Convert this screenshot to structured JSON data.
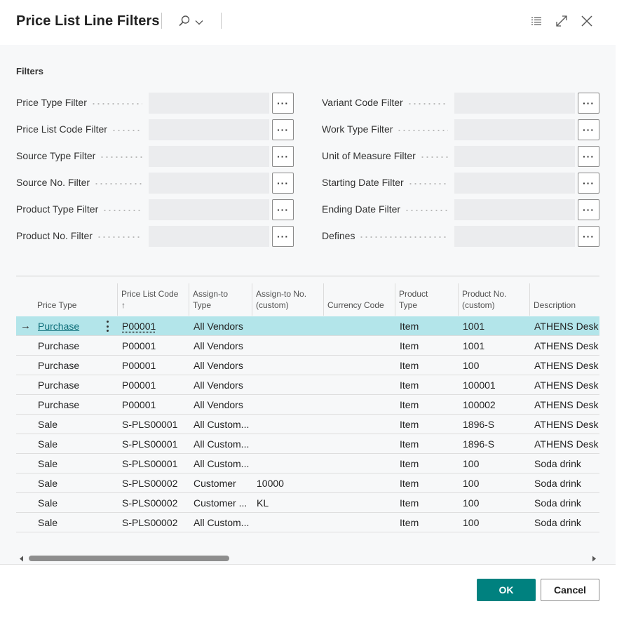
{
  "dialog": {
    "title": "Price List Line Filters",
    "icons": [
      "search-icon",
      "chevron-down-icon",
      "list-icon",
      "expand-icon",
      "close-icon"
    ]
  },
  "filters": {
    "section_title": "Filters",
    "ellipsis": "···",
    "left": [
      {
        "label": "Price Type Filter",
        "value": ""
      },
      {
        "label": "Price List Code Filter",
        "value": ""
      },
      {
        "label": "Source Type Filter",
        "value": ""
      },
      {
        "label": "Source No. Filter",
        "value": ""
      },
      {
        "label": "Product Type Filter",
        "value": ""
      },
      {
        "label": "Product No. Filter",
        "value": ""
      }
    ],
    "right": [
      {
        "label": "Variant Code Filter",
        "value": ""
      },
      {
        "label": "Work Type Filter",
        "value": ""
      },
      {
        "label": "Unit of Measure Filter",
        "value": ""
      },
      {
        "label": "Starting Date Filter",
        "value": ""
      },
      {
        "label": "Ending Date Filter",
        "value": ""
      },
      {
        "label": "Defines",
        "value": ""
      }
    ]
  },
  "table": {
    "columns": [
      {
        "line1": "Price Type",
        "line2": ""
      },
      {
        "line1": "Price List Code",
        "line2": "↑"
      },
      {
        "line1": "Assign-to",
        "line2": "Type"
      },
      {
        "line1": "Assign-to No.",
        "line2": "(custom)"
      },
      {
        "line1": "Currency Code",
        "line2": ""
      },
      {
        "line1": "Product",
        "line2": "Type"
      },
      {
        "line1": "Product No.",
        "line2": "(custom)"
      },
      {
        "line1": "Description",
        "line2": ""
      }
    ],
    "rows": [
      {
        "price_type": "Purchase",
        "price_list_code": "P00001",
        "assign_to_type": "All Vendors",
        "assign_to_no": "",
        "currency_code": "",
        "product_type": "Item",
        "product_no": "1001",
        "description": "ATHENS Desk"
      },
      {
        "price_type": "Purchase",
        "price_list_code": "P00001",
        "assign_to_type": "All Vendors",
        "assign_to_no": "",
        "currency_code": "",
        "product_type": "Item",
        "product_no": "1001",
        "description": "ATHENS Desk"
      },
      {
        "price_type": "Purchase",
        "price_list_code": "P00001",
        "assign_to_type": "All Vendors",
        "assign_to_no": "",
        "currency_code": "",
        "product_type": "Item",
        "product_no": "100",
        "description": "ATHENS Desk"
      },
      {
        "price_type": "Purchase",
        "price_list_code": "P00001",
        "assign_to_type": "All Vendors",
        "assign_to_no": "",
        "currency_code": "",
        "product_type": "Item",
        "product_no": "100001",
        "description": "ATHENS Desk"
      },
      {
        "price_type": "Purchase",
        "price_list_code": "P00001",
        "assign_to_type": "All Vendors",
        "assign_to_no": "",
        "currency_code": "",
        "product_type": "Item",
        "product_no": "100002",
        "description": "ATHENS Desk"
      },
      {
        "price_type": "Sale",
        "price_list_code": "S-PLS00001",
        "assign_to_type": "All Custom...",
        "assign_to_no": "",
        "currency_code": "",
        "product_type": "Item",
        "product_no": "1896-S",
        "description": "ATHENS Desk"
      },
      {
        "price_type": "Sale",
        "price_list_code": "S-PLS00001",
        "assign_to_type": "All Custom...",
        "assign_to_no": "",
        "currency_code": "",
        "product_type": "Item",
        "product_no": "1896-S",
        "description": "ATHENS Desk"
      },
      {
        "price_type": "Sale",
        "price_list_code": "S-PLS00001",
        "assign_to_type": "All Custom...",
        "assign_to_no": "",
        "currency_code": "",
        "product_type": "Item",
        "product_no": "100",
        "description": "Soda drink"
      },
      {
        "price_type": "Sale",
        "price_list_code": "S-PLS00002",
        "assign_to_type": "Customer",
        "assign_to_no": "10000",
        "currency_code": "",
        "product_type": "Item",
        "product_no": "100",
        "description": "Soda drink"
      },
      {
        "price_type": "Sale",
        "price_list_code": "S-PLS00002",
        "assign_to_type": "Customer ...",
        "assign_to_no": "KL",
        "currency_code": "",
        "product_type": "Item",
        "product_no": "100",
        "description": "Soda drink"
      },
      {
        "price_type": "Sale",
        "price_list_code": "S-PLS00002",
        "assign_to_type": "All Custom...",
        "assign_to_no": "",
        "currency_code": "",
        "product_type": "Item",
        "product_no": "100",
        "description": "Soda drink"
      }
    ],
    "selected_row": 0,
    "row_indicator": "→"
  },
  "footer": {
    "ok_label": "OK",
    "cancel_label": "Cancel"
  },
  "colors": {
    "accent": "#00817f",
    "link": "#0e6f7a",
    "selected_row": "#b3e5ea"
  }
}
